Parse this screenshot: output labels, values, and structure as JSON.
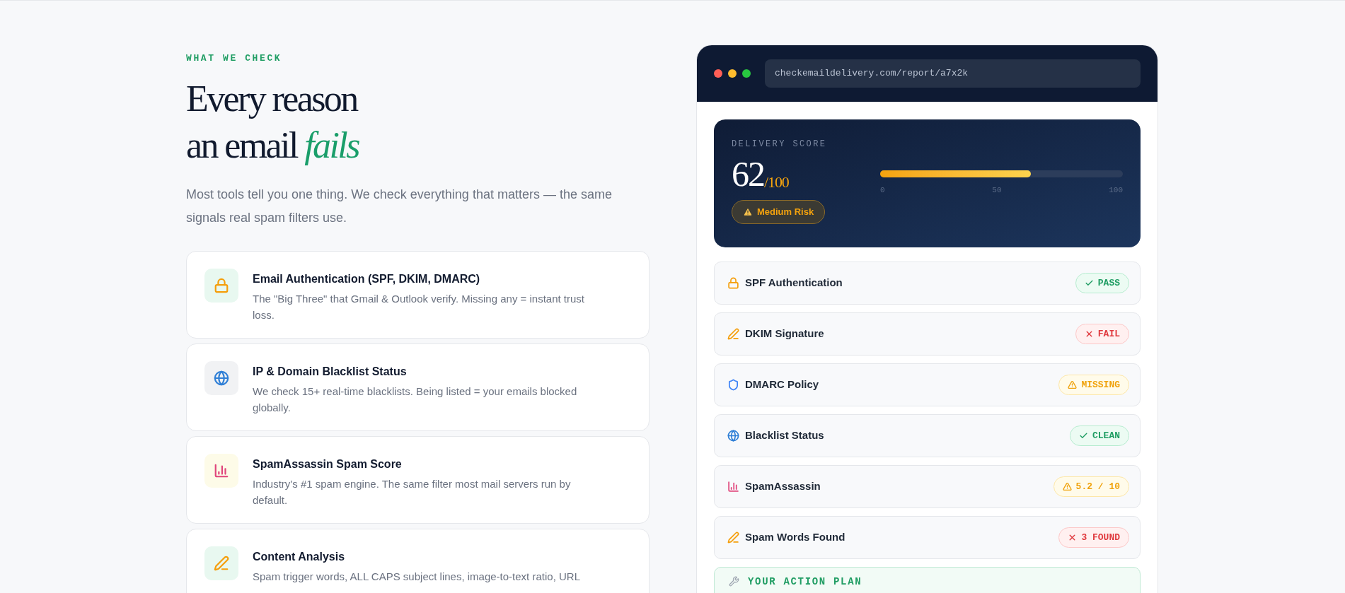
{
  "section": {
    "eyebrow": "WHAT WE CHECK",
    "heading_line_1": "Every reason",
    "heading_line_2": "an email *fails*",
    "intro": "Most tools tell you one thing. We check everything that matters — the same signals real spam filters use."
  },
  "features": [
    {
      "title": "Email Authentication (SPF, DKIM, DMARC)",
      "description": "The \"Big Three\" that Gmail & Outlook verify. Missing any = instant trust loss."
    },
    {
      "title": "IP & Domain Blacklist Status",
      "description": "We check 15+ real-time blacklists. Being listed = your emails blocked globally."
    },
    {
      "title": "SpamAssassin Spam Score",
      "description": "Industry's #1 spam engine. The same filter most mail servers run by default."
    },
    {
      "title": "Content Analysis",
      "description": "Spam trigger words, ALL CAPS subject lines, image-to-text ratio, URL"
    }
  ],
  "browser": {
    "url": "checkemaildelivery.com/report/a7x2k"
  },
  "score_card": {
    "label": "DELIVERY SCORE",
    "score": "62",
    "out_of": "/100",
    "level": 0.62,
    "ticks": [
      "0",
      "50",
      "100"
    ],
    "risk": "Medium Risk"
  },
  "checks": [
    {
      "name": "SPF Authentication",
      "status": "PASS",
      "kind": "pass"
    },
    {
      "name": "DKIM Signature",
      "status": "FAIL",
      "kind": "fail"
    },
    {
      "name": "DMARC Policy",
      "status": "MISSING",
      "kind": "warn"
    },
    {
      "name": "Blacklist Status",
      "status": "CLEAN",
      "kind": "pass"
    },
    {
      "name": "SpamAssassin",
      "status": "5.2 / 10",
      "kind": "warn"
    },
    {
      "name": "Spam Words Found",
      "status": "3 FOUND",
      "kind": "fail"
    }
  ],
  "action_plan": {
    "title": "YOUR ACTION PLAN"
  }
}
